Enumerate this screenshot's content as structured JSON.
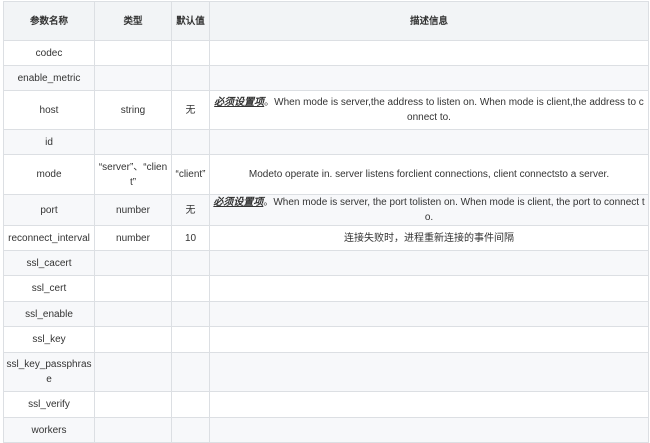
{
  "headers": {
    "name": "参数名称",
    "type": "类型",
    "default": "默认值",
    "desc": "描述信息"
  },
  "rows": [
    {
      "name": "codec",
      "type": "",
      "default": "",
      "req": "",
      "desc": ""
    },
    {
      "name": "enable_metric",
      "type": "",
      "default": "",
      "req": "",
      "desc": ""
    },
    {
      "name": "host",
      "type": "string",
      "default": "无",
      "req": "必须设置项",
      "desc": "。When mode is server,the address to listen on. When mode is client,the address to connect to."
    },
    {
      "name": "id",
      "type": "",
      "default": "",
      "req": "",
      "desc": ""
    },
    {
      "name": "mode",
      "type": "“server”、“client”",
      "default": "“client”",
      "req": "",
      "desc": "Modeto operate in. server listens forclient connections, client connectsto a server."
    },
    {
      "name": "port",
      "type": "number",
      "default": "无",
      "req": "必须设置项",
      "desc": "。When mode is server, the port tolisten on. When mode is client, the port to connect to."
    },
    {
      "name": "reconnect_interval",
      "type": "number",
      "default": "10",
      "req": "",
      "desc": "连接失败时，进程重新连接的事件间隔"
    },
    {
      "name": "ssl_cacert",
      "type": "",
      "default": "",
      "req": "",
      "desc": ""
    },
    {
      "name": "ssl_cert",
      "type": "",
      "default": "",
      "req": "",
      "desc": ""
    },
    {
      "name": "ssl_enable",
      "type": "",
      "default": "",
      "req": "",
      "desc": ""
    },
    {
      "name": "ssl_key",
      "type": "",
      "default": "",
      "req": "",
      "desc": ""
    },
    {
      "name": "ssl_key_passphrase",
      "type": "",
      "default": "",
      "req": "",
      "desc": ""
    },
    {
      "name": "ssl_verify",
      "type": "",
      "default": "",
      "req": "",
      "desc": ""
    },
    {
      "name": "workers",
      "type": "",
      "default": "",
      "req": "",
      "desc": ""
    }
  ]
}
